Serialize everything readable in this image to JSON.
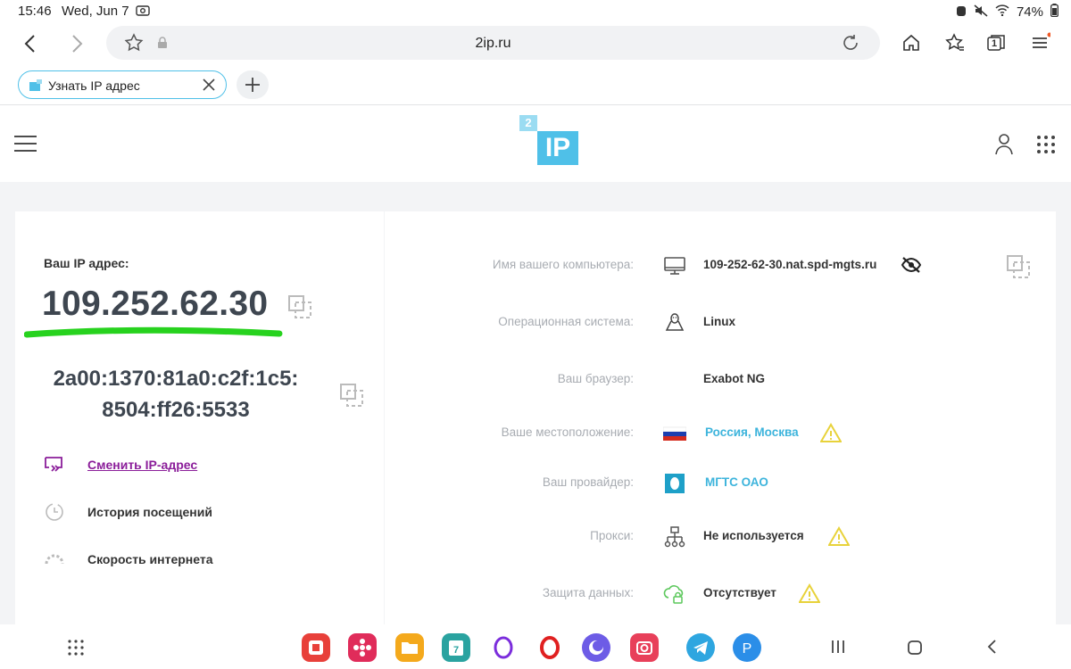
{
  "status_bar": {
    "time": "15:46",
    "date": "Wed, Jun 7",
    "battery": "74%"
  },
  "browser": {
    "url": "2ip.ru",
    "tab_title": "Узнать IP адрес",
    "tab_count": "1"
  },
  "site": {
    "logo_text": "IP",
    "logo_badge": "2"
  },
  "left_panel": {
    "ip_label": "Ваш IP адрес:",
    "ipv4": "109.252.62.30",
    "ipv6_line1": "2a00:1370:81a0:c2f:1c5:",
    "ipv6_line2": "8504:ff26:5533",
    "menu": [
      {
        "label": "Сменить IP-адрес",
        "icon": "change-ip-icon"
      },
      {
        "label": "История посещений",
        "icon": "history-icon"
      },
      {
        "label": "Скорость интернета",
        "icon": "speedometer-icon"
      }
    ]
  },
  "info": [
    {
      "key": "Имя вашего компьютера:",
      "value": "109-252-62-30.nat.spd-mgts.ru",
      "icon": "computer-icon"
    },
    {
      "key": "Операционная система:",
      "value": "Linux",
      "icon": "linux-icon"
    },
    {
      "key": "Ваш браузер:",
      "value": "Exabot NG",
      "icon": ""
    },
    {
      "key": "Ваше местоположение:",
      "value": "Россия, Москва",
      "icon": "russia-flag-icon"
    },
    {
      "key": "Ваш провайдер:",
      "value": "МГТС ОАО",
      "icon": "provider-logo-icon"
    },
    {
      "key": "Прокси:",
      "value": "Не используется",
      "icon": "network-icon"
    },
    {
      "key": "Защита данных:",
      "value": "Отсутствует",
      "icon": "cloud-lock-icon"
    }
  ],
  "colors": {
    "accent": "#4fc0e8",
    "link": "#3db4dc",
    "active_menu": "#8b1e9a",
    "warning": "#e8d23a",
    "underline_marker": "#27d21e"
  }
}
